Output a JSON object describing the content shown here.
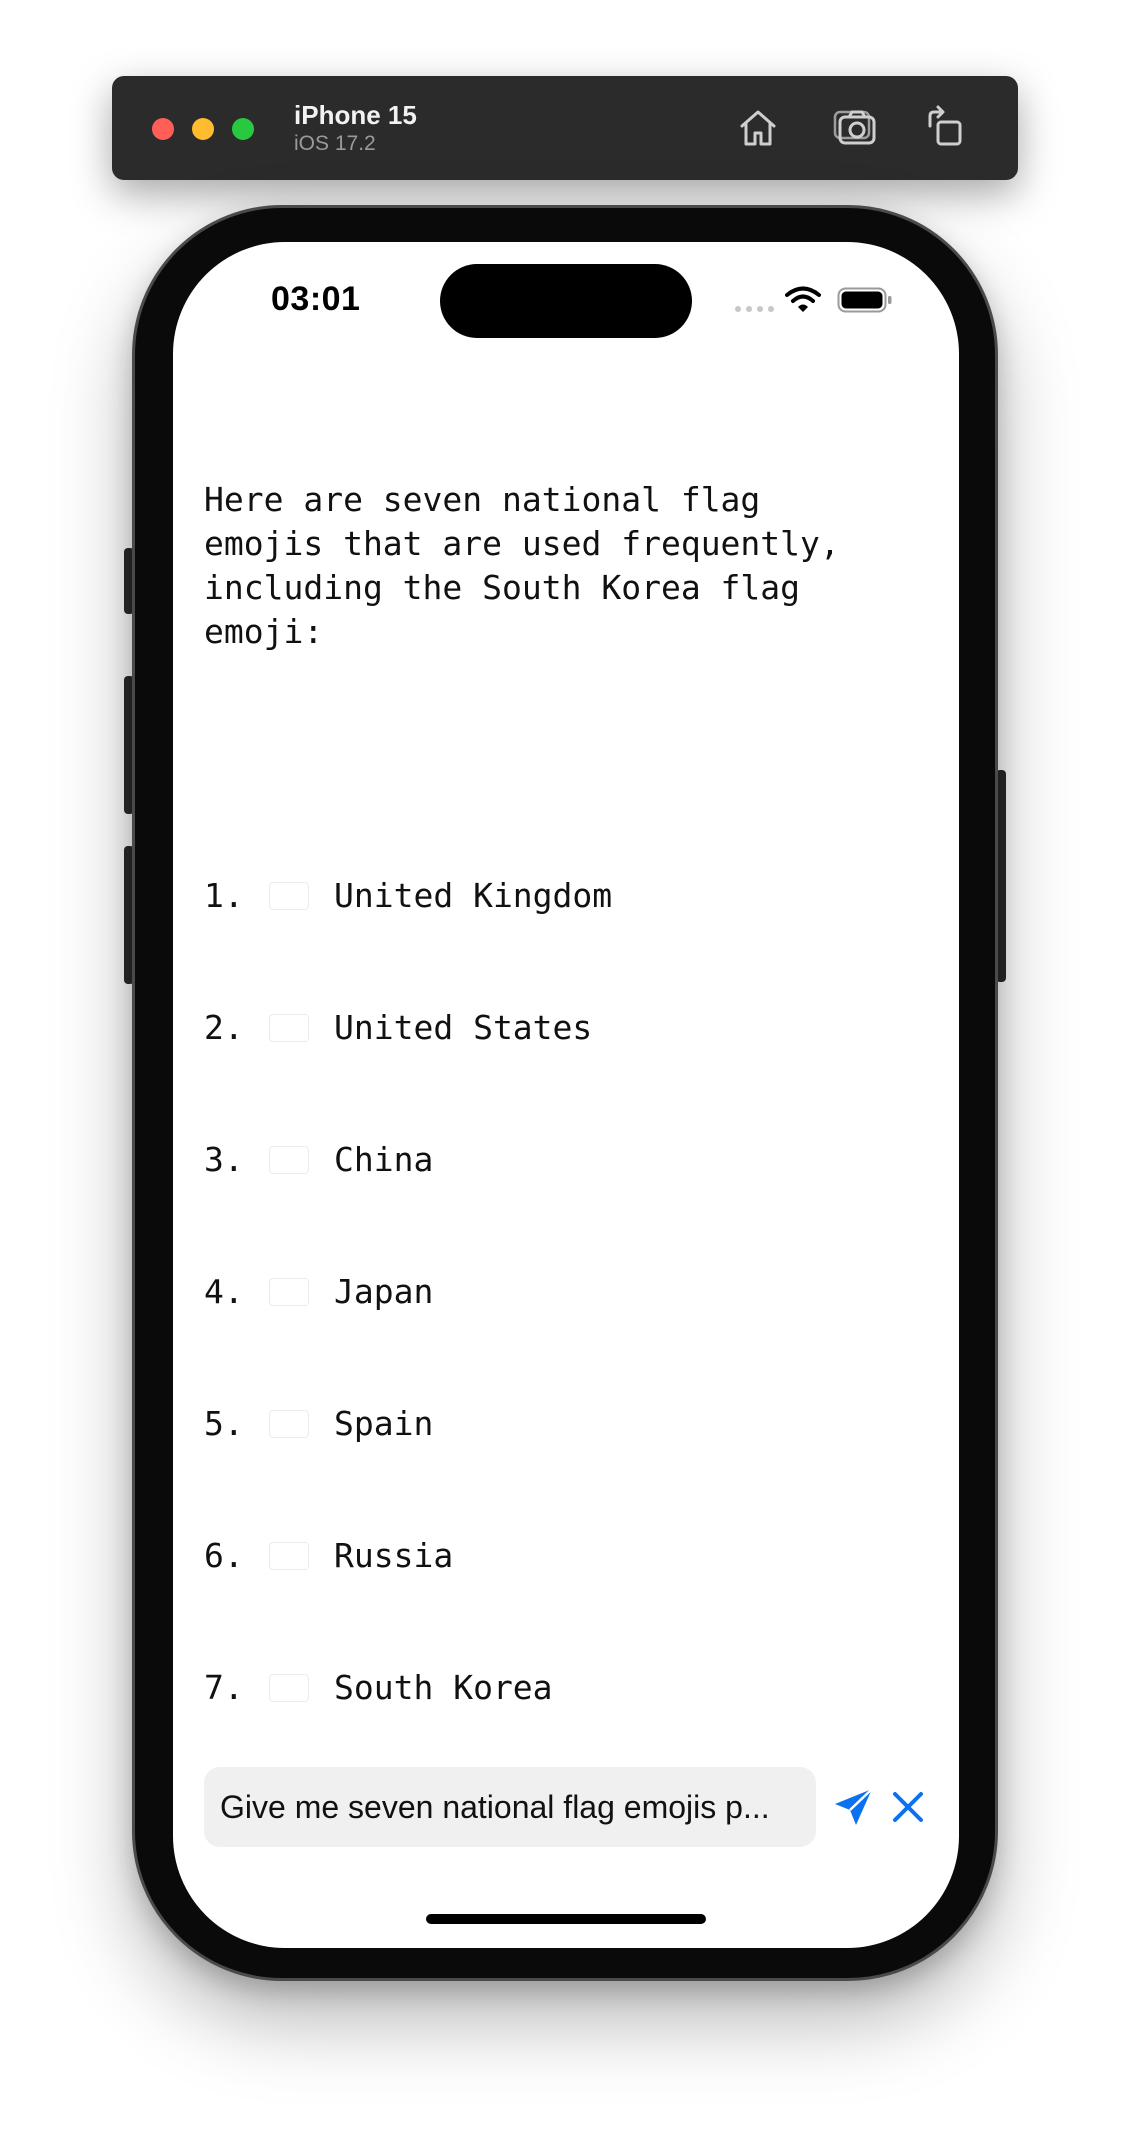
{
  "simulator": {
    "device_name": "iPhone 15",
    "os_version": "iOS 17.2",
    "icons": [
      "home-icon",
      "screenshot-icon",
      "rotate-icon"
    ]
  },
  "status_bar": {
    "time": "03:01",
    "icons": [
      "cellular-signal-icon",
      "wifi-icon",
      "battery-icon"
    ]
  },
  "response": {
    "intro": "Here are seven national flag\nemojis that are used frequently,\nincluding the South Korea flag\nemoji:",
    "items": [
      {
        "number": "1.",
        "flag": "flag-gb",
        "country": "United Kingdom"
      },
      {
        "number": "2.",
        "flag": "flag-us",
        "country": "United States"
      },
      {
        "number": "3.",
        "flag": "flag-cn",
        "country": "China"
      },
      {
        "number": "4.",
        "flag": "flag-jp",
        "country": "Japan"
      },
      {
        "number": "5.",
        "flag": "flag-es",
        "country": "Spain"
      },
      {
        "number": "6.",
        "flag": "flag-ru",
        "country": "Russia"
      },
      {
        "number": "7.",
        "flag": "flag-kr",
        "country": "South Korea"
      }
    ]
  },
  "composer": {
    "input_value": "Give me seven national flag emojis p..."
  },
  "colors": {
    "accent": "#0a72ef",
    "input_background": "#f0f0f0"
  }
}
